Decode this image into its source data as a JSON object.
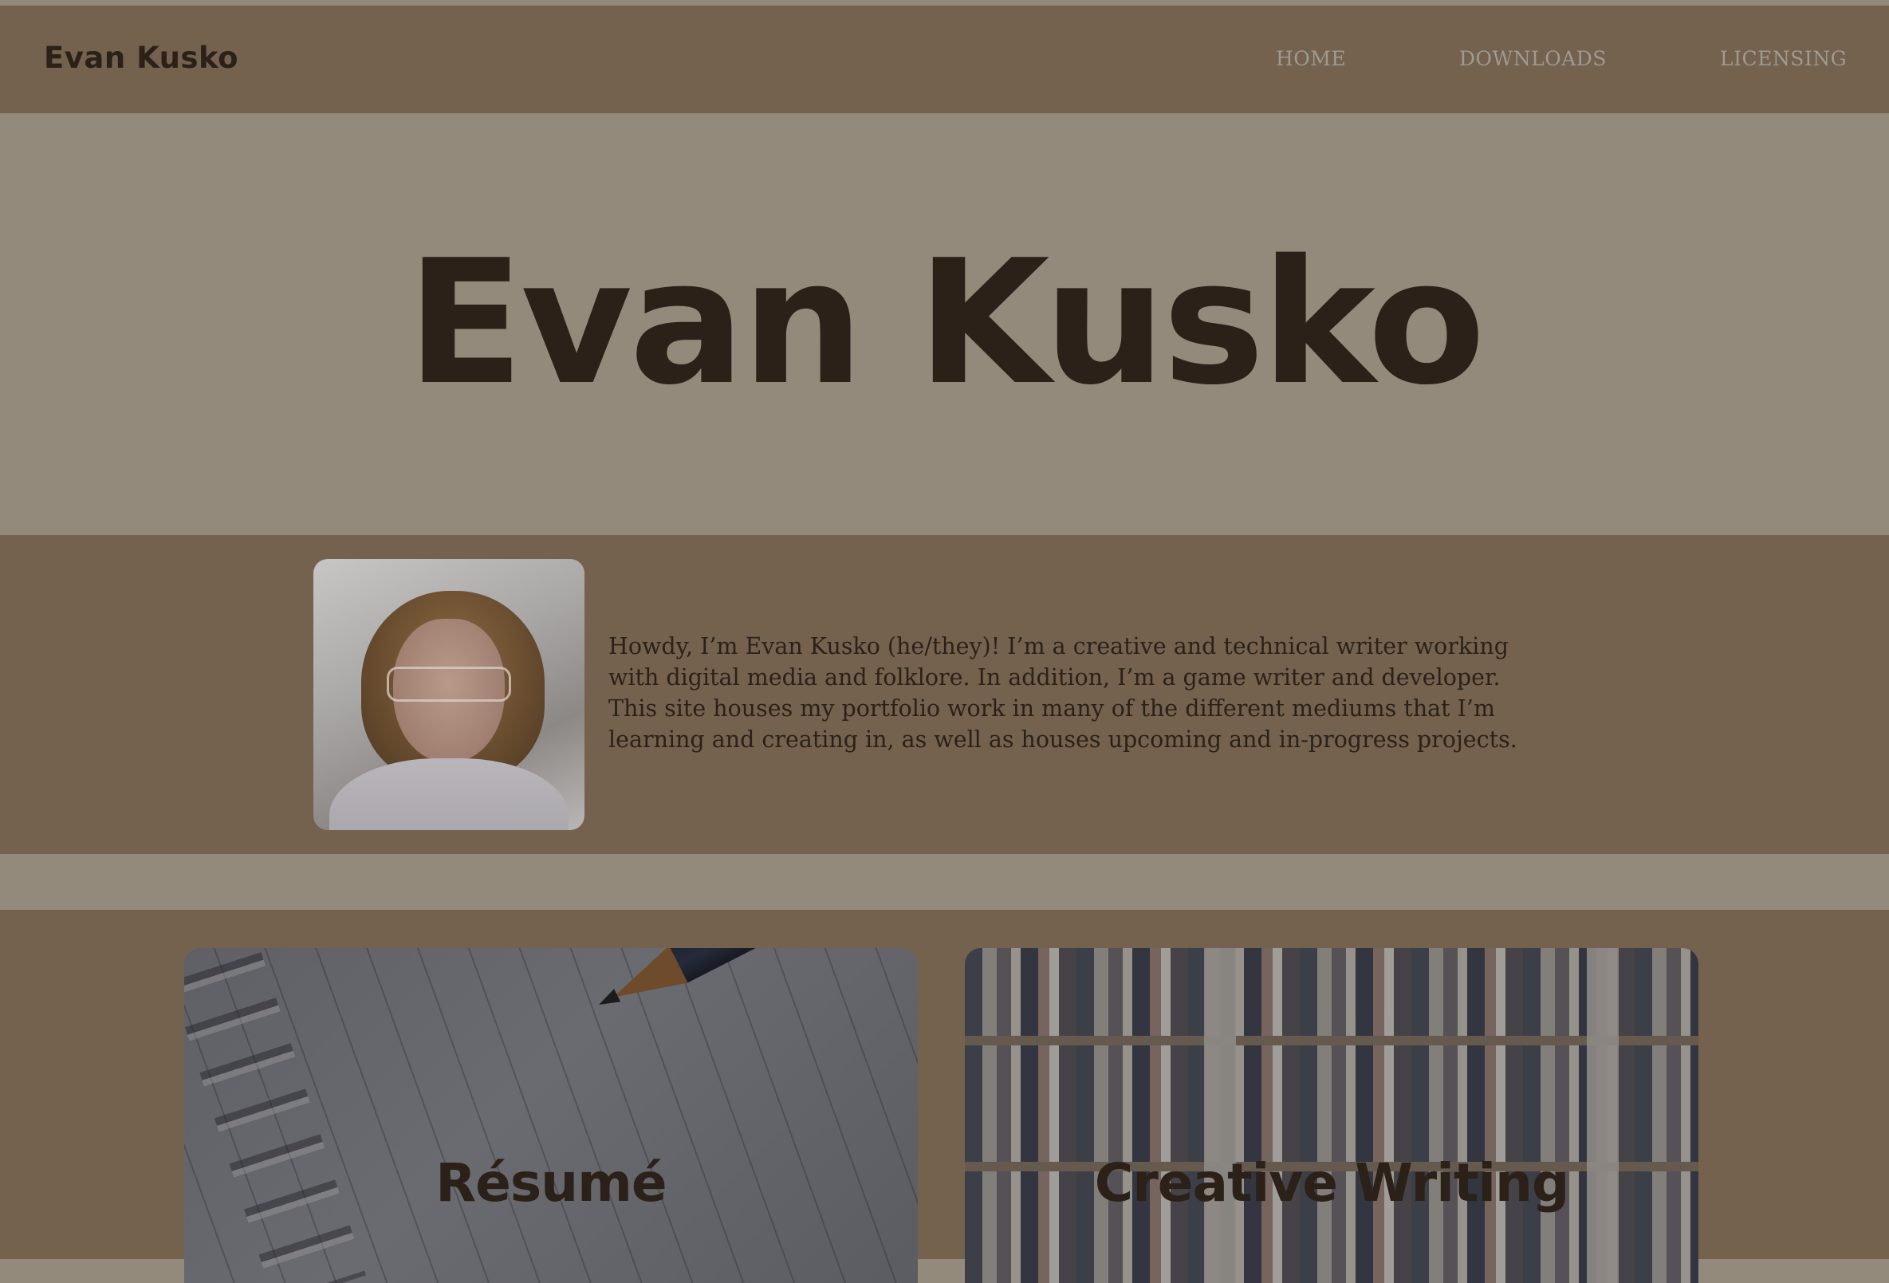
{
  "header": {
    "brand": "Evan Kusko",
    "nav": {
      "home": "HOME",
      "downloads": "DOWNLOADS",
      "licensing": "LICENSING"
    }
  },
  "hero": {
    "title": "Evan Kusko"
  },
  "about": {
    "bio": "Howdy, I’m Evan Kusko (he/they)! I’m a creative and technical writer working with digital media and folklore. In addition, I’m a game writer and developer. This site houses my portfolio work in many of the different mediums that I’m learning and creating in, as well as houses upcoming and in-progress projects."
  },
  "cards": {
    "resume": {
      "title": "Résumé"
    },
    "creative_writing": {
      "title": "Creative Writing"
    }
  },
  "colors": {
    "header_bg": "#74624f",
    "page_bg": "#938a7b",
    "text_dark": "#2b2118",
    "nav_text": "#9f9a92"
  }
}
